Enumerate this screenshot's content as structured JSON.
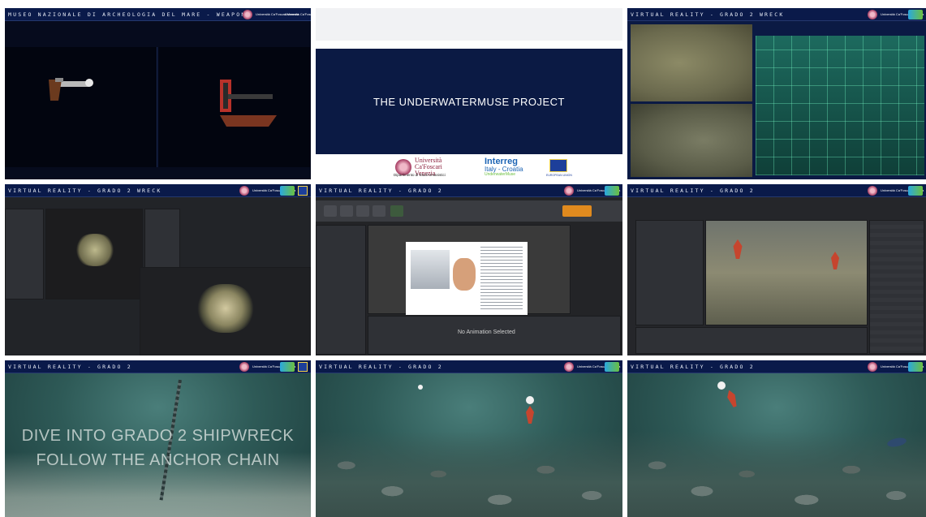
{
  "tiles": [
    {
      "title": "MUSEO NAZIONALE DI ARCHEOLOGIA DEL MARE - WEAPONS"
    },
    {
      "title": "THE UNDERWATERMUSE PROJECT",
      "uni_name": "Università Ca'Foscari Venezia",
      "uni_dept": "Dipartimento di Studi Umanistici",
      "interreg": "Interreg",
      "interreg_sub": "Italy - Croatia",
      "interreg_proj": "UnderwaterMuse",
      "eu": "EUROPEAN UNION"
    },
    {
      "title": "VIRTUAL REALITY - GRADO 2 WRECK"
    },
    {
      "title": "VIRTUAL REALITY - GRADO 2 WRECK"
    },
    {
      "title": "VIRTUAL REALITY - GRADO 2",
      "ue_caption": "No Animation Selected"
    },
    {
      "title": "VIRTUAL REALITY - GRADO 2"
    },
    {
      "title": "VIRTUAL REALITY - GRADO 2",
      "caption_line1": "DIVE INTO GRADO 2 SHIPWRECK",
      "caption_line2": "FOLLOW THE ANCHOR CHAIN"
    },
    {
      "title": "VIRTUAL REALITY - GRADO 2"
    },
    {
      "title": "VIRTUAL REALITY - GRADO 2"
    }
  ],
  "logo": {
    "uni_short": "Università Ca'Foscari Venezia",
    "interreg_short": "Interreg"
  },
  "colors": {
    "navy": "#0b1a44",
    "water": "#2e5a57",
    "ue_bg": "#222428"
  }
}
